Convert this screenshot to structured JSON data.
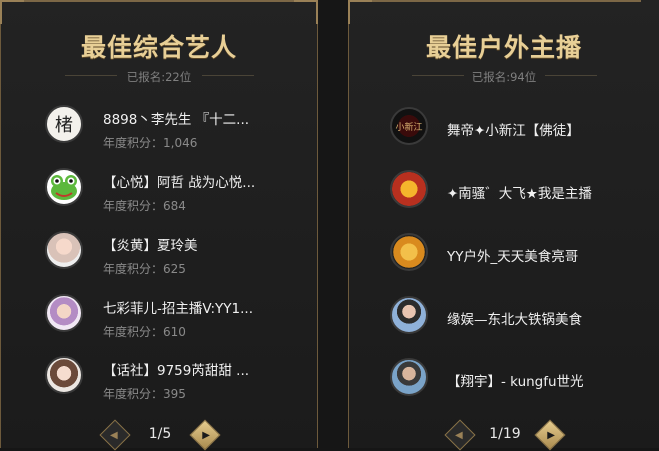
{
  "left": {
    "title": "最佳综合艺人",
    "registered": "已报名:22位",
    "items": [
      {
        "name": "8898丶李先生 『十二...",
        "score": "年度积分：1,046",
        "avatar_icon": "avatar-calligraphy"
      },
      {
        "name": "【心悦】阿哲 战为心悦...",
        "score": "年度积分：684",
        "avatar_icon": "avatar-frog"
      },
      {
        "name": "【炎黄】夏玲美",
        "score": "年度积分：625",
        "avatar_icon": "avatar-woman"
      },
      {
        "name": "七彩菲儿-招主播V:YY1...",
        "score": "年度积分：610",
        "avatar_icon": "avatar-woman-crown"
      },
      {
        "name": "【话社】9759芮甜甜 ...",
        "score": "年度积分：395",
        "avatar_icon": "avatar-woman"
      }
    ],
    "pager": "1/5"
  },
  "right": {
    "title": "最佳户外主播",
    "registered": "已报名:94位",
    "items": [
      {
        "name": "舞帝✦小新江【佛徒】",
        "avatar_icon": "avatar-logo-dark"
      },
      {
        "name": "✦南骚゛大飞★我是主播",
        "avatar_icon": "avatar-logo-fire"
      },
      {
        "name": "YY户外_天天美食亮哥",
        "avatar_icon": "avatar-logo-badge"
      },
      {
        "name": "缘娱—东北大铁锅美食",
        "avatar_icon": "avatar-man"
      },
      {
        "name": "【翔宇】- kungfu世光",
        "avatar_icon": "avatar-man"
      }
    ],
    "pager": "1/19"
  },
  "colors": {
    "gold": "#e8cf96",
    "border": "#6d5a3c",
    "bg": "#1e1e1e"
  }
}
